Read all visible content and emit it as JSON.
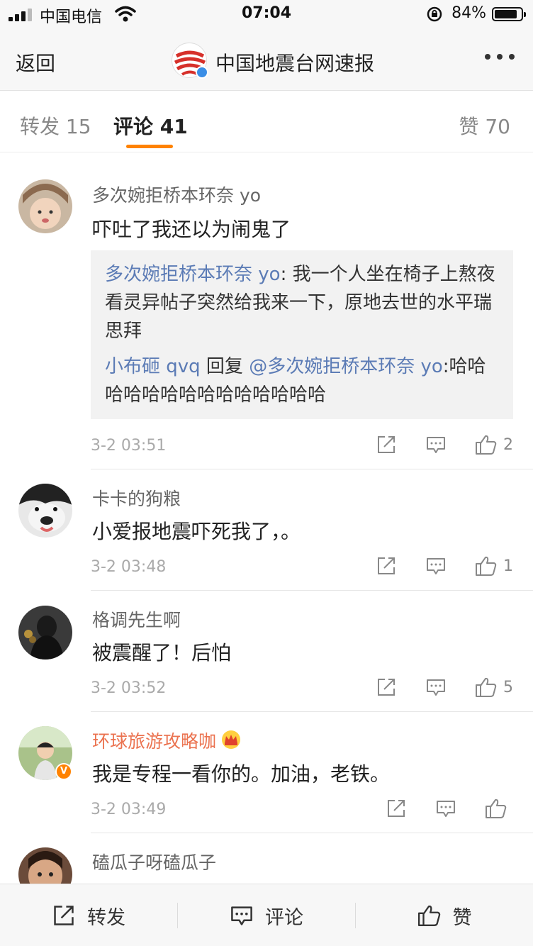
{
  "status": {
    "carrier": "中国电信",
    "time": "07:04",
    "battery": "84%"
  },
  "nav": {
    "back": "返回",
    "title": "中国地震台网速报"
  },
  "tabs": {
    "repost": "转发 15",
    "comment": "评论 41",
    "like": "赞 70"
  },
  "comments": [
    {
      "name": "多次婉拒桥本环奈 yo",
      "text": "吓吐了我还以为闹鬼了",
      "quote": [
        {
          "name": "多次婉拒桥本环奈 yo",
          "text": ": 我一个人坐在椅子上熬夜看灵异帖子突然给我来一下，原地去世的水平瑞思拜"
        },
        {
          "name": "小布砸 qvq",
          "mid": " 回复 ",
          "mention": "@多次婉拒桥本环奈 yo",
          "text": ":哈哈哈哈哈哈哈哈哈哈哈哈哈哈"
        }
      ],
      "time": "3-2 03:51",
      "likes": "2"
    },
    {
      "name": "卡卡的狗粮",
      "text": "小爱报地震吓死我了，。",
      "time": "3-2 03:48",
      "likes": "1"
    },
    {
      "name": "格调先生啊",
      "text": "被震醒了！后怕",
      "time": "3-2 03:52",
      "likes": "5"
    },
    {
      "name": "环球旅游攻略咖",
      "text": "我是专程一看你的。加油，老铁。",
      "time": "3-2 03:49",
      "likes": ""
    },
    {
      "name": "磕瓜子呀磕瓜子"
    }
  ],
  "bottom": {
    "repost": "转发",
    "comment": "评论",
    "like": "赞"
  },
  "colors": {
    "accent": "#ff8200",
    "link": "#5b7bb5",
    "vip_name": "#eb7350"
  }
}
